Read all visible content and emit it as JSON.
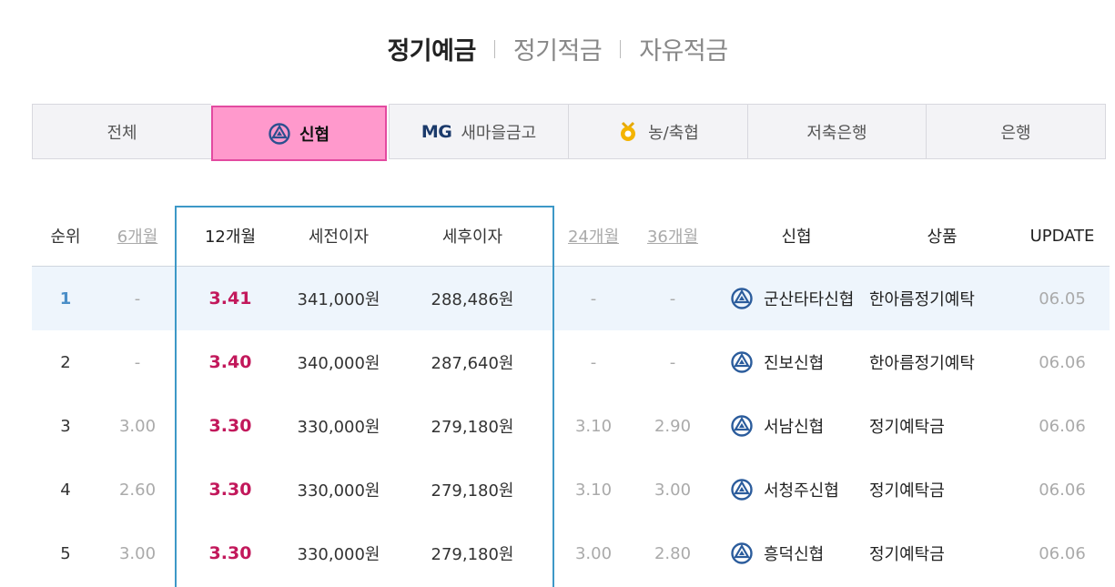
{
  "product_tabs": [
    {
      "label": "정기예금",
      "active": true
    },
    {
      "label": "정기적금",
      "active": false
    },
    {
      "label": "자유적금",
      "active": false
    }
  ],
  "category_tabs": [
    {
      "label": "전체",
      "icon": null,
      "selected": false
    },
    {
      "label": "신협",
      "icon": "shinhyup-logo-icon",
      "selected": true
    },
    {
      "label": "새마을금고",
      "icon": "mg-logo",
      "logo_text": "MG",
      "selected": false
    },
    {
      "label": "농/축협",
      "icon": "nonghyup-logo-icon",
      "selected": false
    },
    {
      "label": "저축은행",
      "icon": null,
      "selected": false
    },
    {
      "label": "은행",
      "icon": null,
      "selected": false
    }
  ],
  "table": {
    "headers": {
      "rank": "순위",
      "m6": "6개월",
      "m12": "12개월",
      "pre_tax": "세전이자",
      "post_tax": "세후이자",
      "m24": "24개월",
      "m36": "36개월",
      "bank": "신협",
      "product": "상품",
      "update": "UPDATE"
    },
    "rows": [
      {
        "rank": "1",
        "m6": "-",
        "m12": "3.41",
        "pre_tax": "341,000원",
        "post_tax": "288,486원",
        "m24": "-",
        "m36": "-",
        "bank": "군산타타신협",
        "product": "한아름정기예탁",
        "update": "06.05"
      },
      {
        "rank": "2",
        "m6": "-",
        "m12": "3.40",
        "pre_tax": "340,000원",
        "post_tax": "287,640원",
        "m24": "-",
        "m36": "-",
        "bank": "진보신협",
        "product": "한아름정기예탁",
        "update": "06.06"
      },
      {
        "rank": "3",
        "m6": "3.00",
        "m12": "3.30",
        "pre_tax": "330,000원",
        "post_tax": "279,180원",
        "m24": "3.10",
        "m36": "2.90",
        "bank": "서남신협",
        "product": "정기예탁금",
        "update": "06.06"
      },
      {
        "rank": "4",
        "m6": "2.60",
        "m12": "3.30",
        "pre_tax": "330,000원",
        "post_tax": "279,180원",
        "m24": "3.10",
        "m36": "3.00",
        "bank": "서청주신협",
        "product": "정기예탁금",
        "update": "06.06"
      },
      {
        "rank": "5",
        "m6": "3.00",
        "m12": "3.30",
        "pre_tax": "330,000원",
        "post_tax": "279,180원",
        "m24": "3.00",
        "m36": "2.80",
        "bank": "흥덕신협",
        "product": "정기예탁금",
        "update": "06.06"
      }
    ]
  },
  "colors": {
    "accent_pink": "#ff99cc",
    "rate_highlight": "#c2185b",
    "column_box": "#3d98c7",
    "first_row_bg": "#eef5fc"
  }
}
